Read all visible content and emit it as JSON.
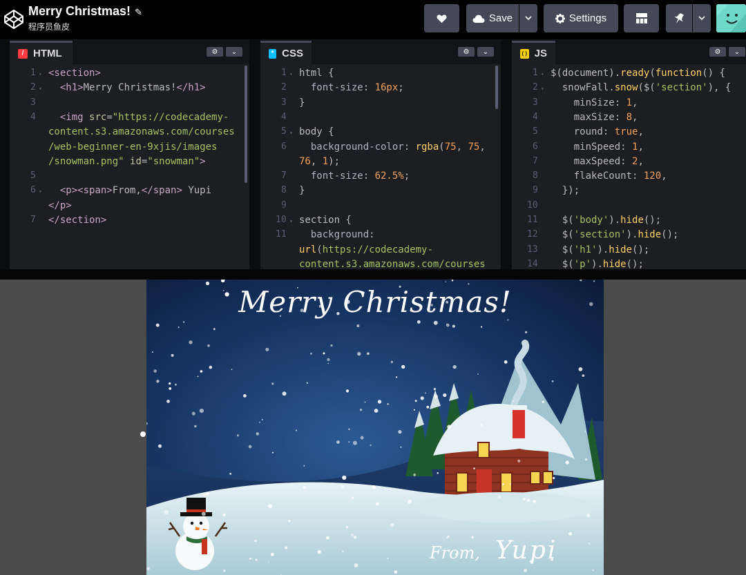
{
  "header": {
    "title": "Merry Christmas!",
    "author": "程序员鱼皮",
    "save_label": "Save",
    "settings_label": "Settings"
  },
  "panes": [
    {
      "id": "html",
      "label": "HTML",
      "icon_color": "#ff3c41",
      "icon_glyph": "/"
    },
    {
      "id": "css",
      "label": "CSS",
      "icon_color": "#0ebeff",
      "icon_glyph": "*"
    },
    {
      "id": "js",
      "label": "JS",
      "icon_color": "#fcd000",
      "icon_glyph": "( )"
    }
  ],
  "html_code": [
    {
      "n": "1",
      "fold": true,
      "parts": [
        [
          "tg",
          "<section>"
        ]
      ]
    },
    {
      "n": "2",
      "fold": true,
      "parts": [
        [
          "t",
          "  "
        ],
        [
          "tg",
          "<h1>"
        ],
        [
          "t",
          "Merry Christmas!"
        ],
        [
          "tg",
          "</h1>"
        ]
      ]
    },
    {
      "n": "3",
      "parts": []
    },
    {
      "n": "4",
      "parts": [
        [
          "t",
          "  "
        ],
        [
          "tg",
          "<img "
        ],
        [
          "at",
          "src"
        ],
        [
          "t",
          "="
        ],
        [
          "st",
          "\"https://codecademy-"
        ]
      ]
    },
    {
      "n": "",
      "parts": [
        [
          "st",
          "content.s3.amazonaws.com/courses"
        ]
      ]
    },
    {
      "n": "",
      "parts": [
        [
          "st",
          "/web-beginner-en-9xjis/images"
        ]
      ]
    },
    {
      "n": "",
      "parts": [
        [
          "st",
          "/snowman.png\""
        ],
        [
          "t",
          " "
        ],
        [
          "at",
          "id"
        ],
        [
          "t",
          "="
        ],
        [
          "st",
          "\"snowman\""
        ],
        [
          "tg",
          ">"
        ]
      ]
    },
    {
      "n": "5",
      "parts": []
    },
    {
      "n": "6",
      "fold": true,
      "parts": [
        [
          "t",
          "  "
        ],
        [
          "tg",
          "<p><span>"
        ],
        [
          "t",
          "From,"
        ],
        [
          "tg",
          "</span>"
        ],
        [
          "t",
          " Yupi"
        ]
      ]
    },
    {
      "n": "",
      "parts": [
        [
          "tg",
          "</p>"
        ]
      ]
    },
    {
      "n": "7",
      "parts": [
        [
          "tg",
          "</section>"
        ]
      ]
    }
  ],
  "css_code": [
    {
      "n": "1",
      "fold": true,
      "parts": [
        [
          "t",
          "html {"
        ]
      ]
    },
    {
      "n": "2",
      "parts": [
        [
          "pr",
          "  font-size"
        ],
        [
          "t",
          ": "
        ],
        [
          "nm",
          "16px"
        ],
        [
          "t",
          ";"
        ]
      ]
    },
    {
      "n": "3",
      "parts": [
        [
          "t",
          "}"
        ]
      ]
    },
    {
      "n": "4",
      "parts": []
    },
    {
      "n": "5",
      "fold": true,
      "parts": [
        [
          "t",
          "body {"
        ]
      ]
    },
    {
      "n": "6",
      "parts": [
        [
          "pr",
          "  background-color"
        ],
        [
          "t",
          ": "
        ],
        [
          "kw",
          "rgba"
        ],
        [
          "t",
          "("
        ],
        [
          "nm",
          "75"
        ],
        [
          "t",
          ", "
        ],
        [
          "nm",
          "75"
        ],
        [
          "t",
          ","
        ]
      ]
    },
    {
      "n": "",
      "parts": [
        [
          "nm",
          "76"
        ],
        [
          "t",
          ", "
        ],
        [
          "nm",
          "1"
        ],
        [
          "t",
          ");"
        ]
      ]
    },
    {
      "n": "7",
      "parts": [
        [
          "pr",
          "  font-size"
        ],
        [
          "t",
          ": "
        ],
        [
          "nm",
          "62.5%"
        ],
        [
          "t",
          ";"
        ]
      ]
    },
    {
      "n": "8",
      "parts": [
        [
          "t",
          "}"
        ]
      ]
    },
    {
      "n": "9",
      "parts": []
    },
    {
      "n": "10",
      "fold": true,
      "parts": [
        [
          "t",
          "section {"
        ]
      ]
    },
    {
      "n": "11",
      "parts": [
        [
          "pr",
          "  background"
        ],
        [
          "t",
          ":"
        ]
      ]
    },
    {
      "n": "",
      "parts": [
        [
          "kw",
          "url"
        ],
        [
          "t",
          "("
        ],
        [
          "st",
          "https://codecademy-"
        ]
      ]
    },
    {
      "n": "",
      "parts": [
        [
          "st",
          "content.s3.amazonaws.com/courses"
        ]
      ]
    }
  ],
  "js_code": [
    {
      "n": "1",
      "fold": true,
      "parts": [
        [
          "t",
          "$(document)."
        ],
        [
          "kw",
          "ready"
        ],
        [
          "t",
          "("
        ],
        [
          "kw",
          "function"
        ],
        [
          "t",
          "() {"
        ]
      ]
    },
    {
      "n": "2",
      "fold": true,
      "parts": [
        [
          "t",
          "  snowFall."
        ],
        [
          "kw",
          "snow"
        ],
        [
          "t",
          "($("
        ],
        [
          "st",
          "'section'"
        ],
        [
          "t",
          "), {"
        ]
      ]
    },
    {
      "n": "3",
      "parts": [
        [
          "t",
          "    minSize: "
        ],
        [
          "nm",
          "1"
        ],
        [
          "t",
          ","
        ]
      ]
    },
    {
      "n": "4",
      "parts": [
        [
          "t",
          "    maxSize: "
        ],
        [
          "nm",
          "8"
        ],
        [
          "t",
          ","
        ]
      ]
    },
    {
      "n": "5",
      "parts": [
        [
          "t",
          "    round: "
        ],
        [
          "nm",
          "true"
        ],
        [
          "t",
          ","
        ]
      ]
    },
    {
      "n": "6",
      "parts": [
        [
          "t",
          "    minSpeed: "
        ],
        [
          "nm",
          "1"
        ],
        [
          "t",
          ","
        ]
      ]
    },
    {
      "n": "7",
      "parts": [
        [
          "t",
          "    maxSpeed: "
        ],
        [
          "nm",
          "2"
        ],
        [
          "t",
          ","
        ]
      ]
    },
    {
      "n": "8",
      "parts": [
        [
          "t",
          "    flakeCount: "
        ],
        [
          "nm",
          "120"
        ],
        [
          "t",
          ","
        ]
      ]
    },
    {
      "n": "9",
      "parts": [
        [
          "t",
          "  });"
        ]
      ]
    },
    {
      "n": "10",
      "parts": []
    },
    {
      "n": "11",
      "parts": [
        [
          "t",
          "  $("
        ],
        [
          "st",
          "'body'"
        ],
        [
          "t",
          ")."
        ],
        [
          "kw",
          "hide"
        ],
        [
          "t",
          "();"
        ]
      ]
    },
    {
      "n": "12",
      "parts": [
        [
          "t",
          "  $("
        ],
        [
          "st",
          "'section'"
        ],
        [
          "t",
          ")."
        ],
        [
          "kw",
          "hide"
        ],
        [
          "t",
          "();"
        ]
      ]
    },
    {
      "n": "13",
      "parts": [
        [
          "t",
          "  $("
        ],
        [
          "st",
          "'h1'"
        ],
        [
          "t",
          ")."
        ],
        [
          "kw",
          "hide"
        ],
        [
          "t",
          "();"
        ]
      ]
    },
    {
      "n": "14",
      "parts": [
        [
          "t",
          "  $("
        ],
        [
          "st",
          "'p'"
        ],
        [
          "t",
          ")."
        ],
        [
          "kw",
          "hide"
        ],
        [
          "t",
          "();"
        ]
      ]
    }
  ],
  "card": {
    "title": "Merry Christmas!",
    "from": "From,",
    "name": "Yupi"
  }
}
